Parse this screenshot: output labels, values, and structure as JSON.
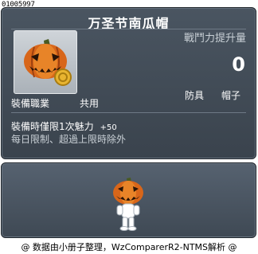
{
  "item_id": "01005997",
  "item_name": "万圣节南瓜帽",
  "stat": {
    "label": "戰鬥力提升量",
    "value": "0"
  },
  "tags": [
    "防具",
    "帽子"
  ],
  "job": {
    "label": "裝備職業",
    "value": "共用"
  },
  "description": {
    "line1": "裝備時僅限1次魅力",
    "bonus": "+50",
    "line2": "每日限制、超過上限時除外"
  },
  "footer": "@ 数据由小册子整理，WzComparerR2-NTMS解析 @",
  "colors": {
    "tooltip_bg": "#434d58",
    "pumpkin": "#e07a1a",
    "text": "#ffffff"
  },
  "icons": [
    "pumpkin-hat-icon",
    "coin-icon",
    "character-preview"
  ]
}
